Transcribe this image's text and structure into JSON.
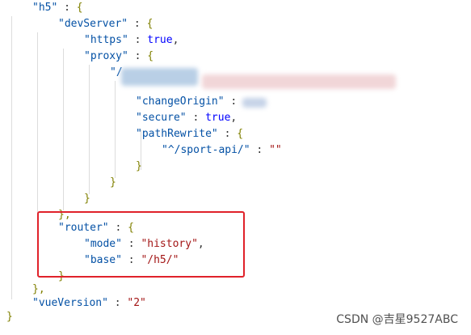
{
  "code": {
    "h5_key": "\"h5\"",
    "devServer_key": "\"devServer\"",
    "https_key": "\"https\"",
    "https_value": "true",
    "proxy_key": "\"proxy\"",
    "proxy_target_key": "\"/",
    "changeOrigin_key": "\"changeOrigin\"",
    "secure_key": "\"secure\"",
    "secure_value": "true",
    "pathRewrite_key": "\"pathRewrite\"",
    "pathRewrite_rule_key": "\"^/sport-api/\"",
    "pathRewrite_rule_value": "\"\"",
    "router_key": "\"router\"",
    "mode_key": "\"mode\"",
    "mode_value": "\"history\"",
    "base_key": "\"base\"",
    "base_value": "\"/h5/\"",
    "vueVersion_key": "\"vueVersion\"",
    "vueVersion_value": "\"2\""
  },
  "watermark": "CSDN @吉星9527ABC",
  "colors": {
    "key": "#0451a5",
    "string": "#a31515",
    "keyword": "#0000ff",
    "highlight_border": "#e0222a"
  }
}
